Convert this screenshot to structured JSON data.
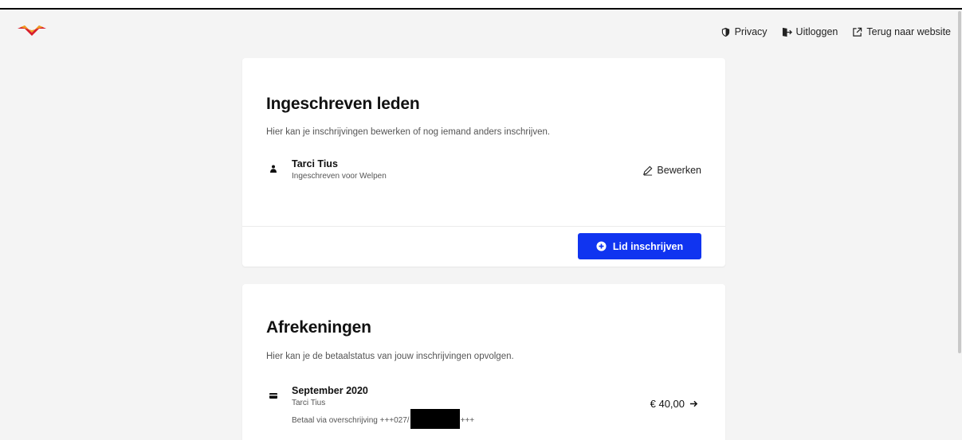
{
  "topnav": {
    "privacy": "Privacy",
    "logout": "Uitloggen",
    "back": "Terug naar website"
  },
  "members": {
    "title": "Ingeschreven leden",
    "description": "Hier kan je inschrijvingen bewerken of nog iemand anders inschrijven.",
    "items": [
      {
        "name": "Tarci Tius",
        "status": "Ingeschreven voor Welpen",
        "edit_label": "Bewerken"
      }
    ],
    "add_button": "Lid inschrijven"
  },
  "payments": {
    "title": "Afrekeningen",
    "description": "Hier kan je de betaalstatus van jouw inschrijvingen opvolgen.",
    "items": [
      {
        "title": "September 2020",
        "member": "Tarci Tius",
        "payment_prefix": "Betaal via overschrijving +++027/",
        "payment_suffix": "+++",
        "amount": "€ 40,00"
      }
    ]
  },
  "colors": {
    "accent": "#1034f0",
    "logo_orange": "#f0a020",
    "logo_red": "#d81e2c"
  },
  "icons": [
    "brand-logo-icon",
    "shield-icon",
    "logout-icon",
    "external-link-icon",
    "user-icon",
    "pencil-icon",
    "plus-circle-icon",
    "card-icon",
    "arrow-right-icon"
  ]
}
